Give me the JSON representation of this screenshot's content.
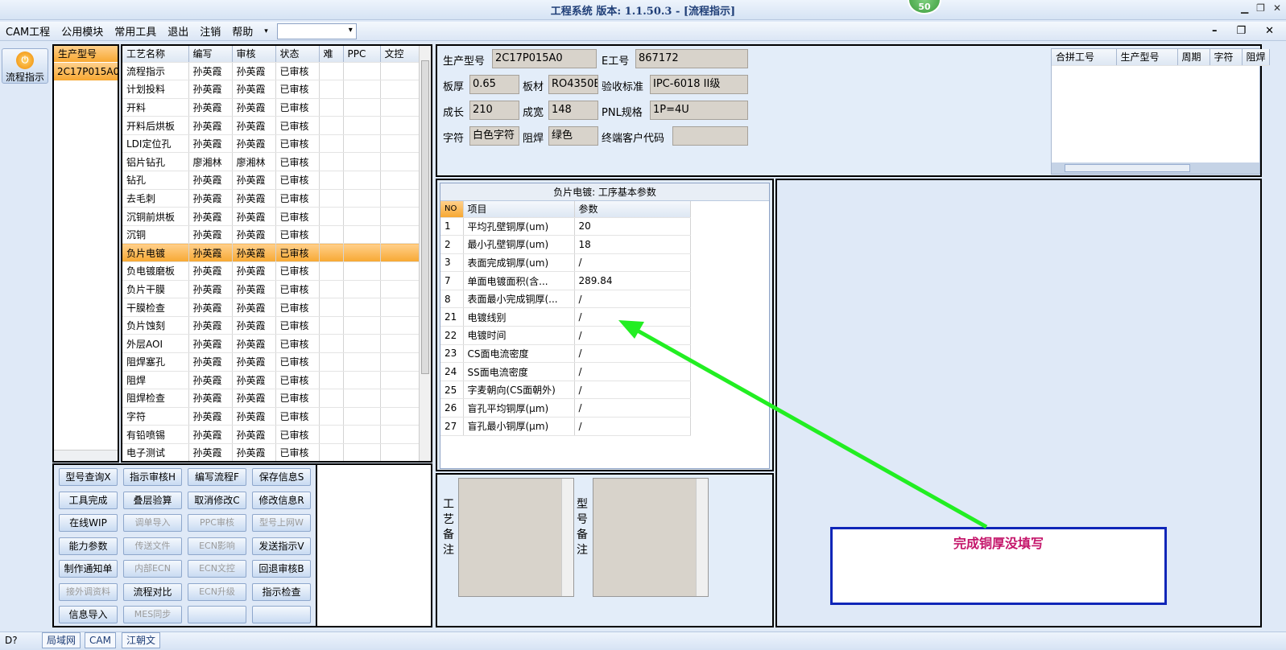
{
  "window": {
    "title": "工程系统  版本: 1.1.50.3 - [流程指示]",
    "badge": "50"
  },
  "menu": [
    "CAM工程",
    "公用模块",
    "常用工具",
    "退出",
    "注销",
    "帮助",
    "▾"
  ],
  "sidebar": {
    "icon_label": "流程指示"
  },
  "model_list": {
    "header": "生产型号",
    "items": [
      "2C17P015A0"
    ]
  },
  "process_grid": {
    "columns": [
      "工艺名称",
      "编写",
      "审核",
      "状态",
      "难",
      "PPC",
      "文控"
    ],
    "rows": [
      [
        "流程指示",
        "孙英霞",
        "孙英霞",
        "已审核"
      ],
      [
        "计划投料",
        "孙英霞",
        "孙英霞",
        "已审核"
      ],
      [
        "开料",
        "孙英霞",
        "孙英霞",
        "已审核"
      ],
      [
        "开料后烘板",
        "孙英霞",
        "孙英霞",
        "已审核"
      ],
      [
        "LDI定位孔",
        "孙英霞",
        "孙英霞",
        "已审核"
      ],
      [
        "铝片钻孔",
        "廖湘林",
        "廖湘林",
        "已审核"
      ],
      [
        "钻孔",
        "孙英霞",
        "孙英霞",
        "已审核"
      ],
      [
        "去毛刺",
        "孙英霞",
        "孙英霞",
        "已审核"
      ],
      [
        "沉铜前烘板",
        "孙英霞",
        "孙英霞",
        "已审核"
      ],
      [
        "沉铜",
        "孙英霞",
        "孙英霞",
        "已审核"
      ],
      [
        "负片电镀",
        "孙英霞",
        "孙英霞",
        "已审核"
      ],
      [
        "负电镀磨板",
        "孙英霞",
        "孙英霞",
        "已审核"
      ],
      [
        "负片干膜",
        "孙英霞",
        "孙英霞",
        "已审核"
      ],
      [
        "干膜检查",
        "孙英霞",
        "孙英霞",
        "已审核"
      ],
      [
        "负片蚀刻",
        "孙英霞",
        "孙英霞",
        "已审核"
      ],
      [
        "外层AOI",
        "孙英霞",
        "孙英霞",
        "已审核"
      ],
      [
        "阻焊塞孔",
        "孙英霞",
        "孙英霞",
        "已审核"
      ],
      [
        "阻焊",
        "孙英霞",
        "孙英霞",
        "已审核"
      ],
      [
        "阻焊检查",
        "孙英霞",
        "孙英霞",
        "已审核"
      ],
      [
        "字符",
        "孙英霞",
        "孙英霞",
        "已审核"
      ],
      [
        "有铅喷锡",
        "孙英霞",
        "孙英霞",
        "已审核"
      ],
      [
        "电子测试",
        "孙英霞",
        "孙英霞",
        "已审核"
      ]
    ],
    "selected_row": 10
  },
  "buttons": [
    [
      "型号查询X",
      "指示审核H",
      "编写流程F",
      "保存信息S"
    ],
    [
      "工具完成",
      "叠层验算",
      "取消修改C",
      "修改信息R"
    ],
    [
      "在线WIP",
      "调单导入",
      "PPC审核",
      "型号上网W"
    ],
    [
      "能力参数",
      "传送文件",
      "ECN影响",
      "发送指示V"
    ],
    [
      "制作通知单",
      "内部ECN",
      "ECN文控",
      "回退审核B"
    ],
    [
      "接外调资料",
      "流程对比",
      "ECN升级",
      "指示检查"
    ],
    [
      "信息导入",
      "MES同步",
      "",
      ""
    ]
  ],
  "info": {
    "prod_model_label": "生产型号",
    "prod_model": "2C17P015A0",
    "e_no_label": "E工号",
    "e_no": "867172",
    "thickness_label": "板厚",
    "thickness": "0.65",
    "material_label": "板材",
    "material": "RO4350B",
    "standard_label": "验收标准",
    "standard": "IPC-6018 II级",
    "length_label": "成长",
    "length": "210",
    "width_label": "成宽",
    "width": "148",
    "pnl_label": "PNL规格",
    "pnl": "1P=4U",
    "char_label": "字符",
    "char": "白色字符",
    "mask_label": "阻焊",
    "mask": "绿色",
    "customer_label": "终端客户代码",
    "customer": ""
  },
  "merge_grid": {
    "columns": [
      "合拼工号",
      "生产型号",
      "周期",
      "字符",
      "阻焊"
    ]
  },
  "params": {
    "title": "负片电镀: 工序基本参数",
    "columns": [
      "NO",
      "项目",
      "参数"
    ],
    "rows": [
      [
        "1",
        "平均孔壁铜厚(um)",
        "20"
      ],
      [
        "2",
        "最小孔壁铜厚(um)",
        "18"
      ],
      [
        "3",
        "表面完成铜厚(um)",
        "/"
      ],
      [
        "7",
        "单面电镀面积(含...",
        "289.84"
      ],
      [
        "8",
        "表面最小完成铜厚(...",
        "/"
      ],
      [
        "21",
        "电镀线别",
        "/"
      ],
      [
        "22",
        "电镀时间",
        "/"
      ],
      [
        "23",
        "CS面电流密度",
        "/"
      ],
      [
        "24",
        "SS面电流密度",
        "/"
      ],
      [
        "25",
        "字麦朝向(CS面朝外)",
        "/"
      ],
      [
        "26",
        "盲孔平均铜厚(μm)",
        "/"
      ],
      [
        "27",
        "盲孔最小铜厚(μm)",
        "/"
      ]
    ]
  },
  "notes": {
    "process_label": "工艺备注",
    "model_label": "型号备注"
  },
  "annotation": {
    "text": "完成铜厚没填写",
    "color": "#c4156a",
    "arrow_color": "#22ee22"
  },
  "statusbar": {
    "tabs": [
      "局域网",
      "CAM",
      "江朝文"
    ],
    "left": "D?"
  }
}
